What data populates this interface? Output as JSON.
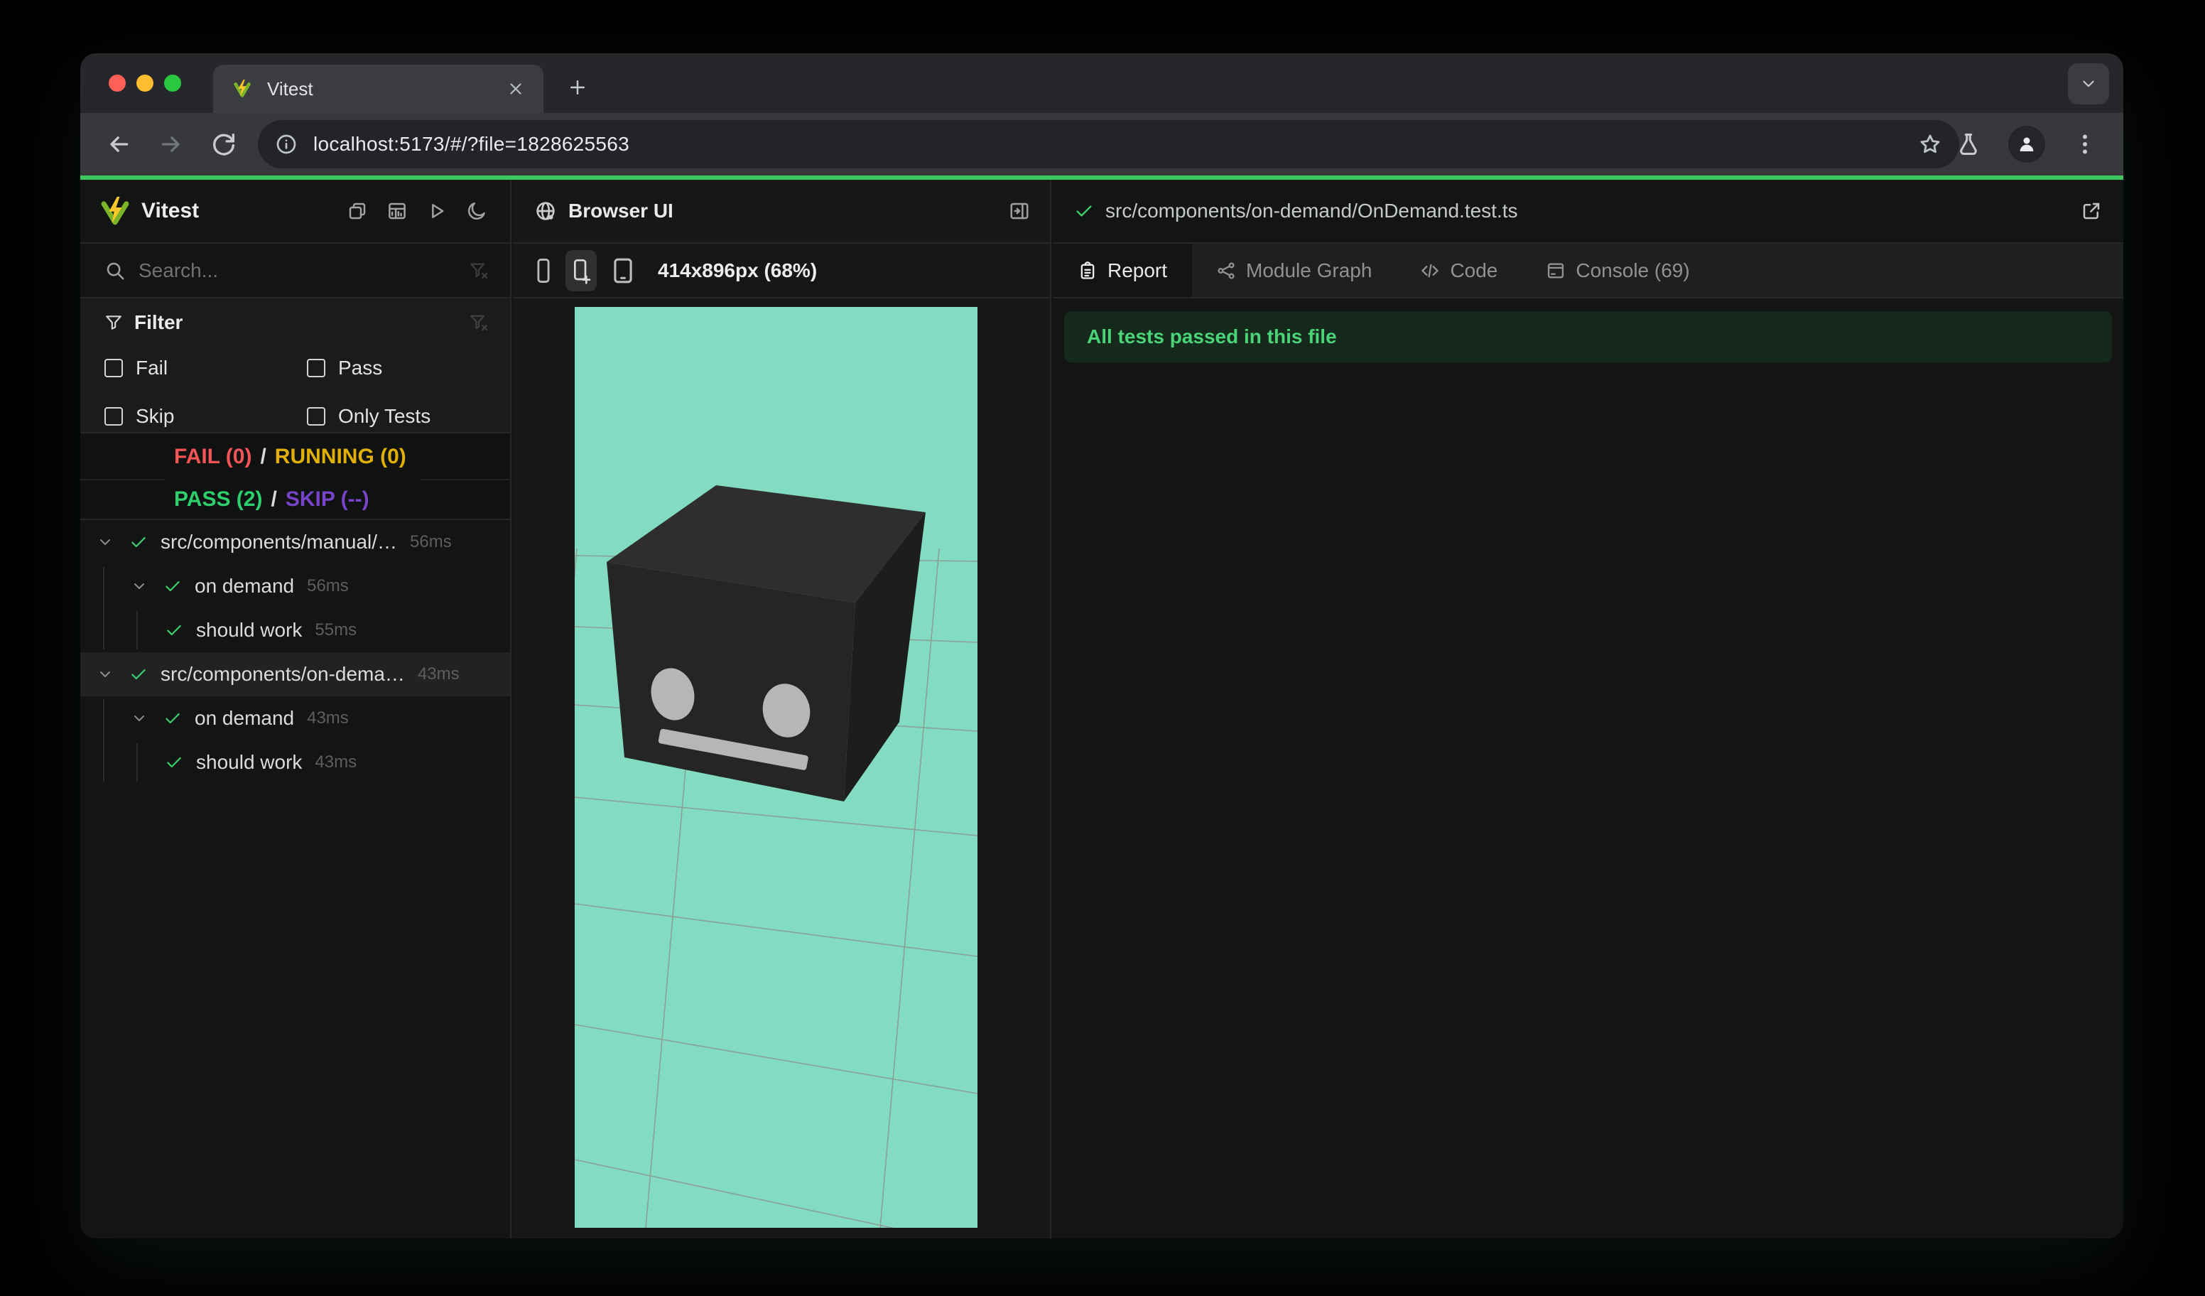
{
  "browser": {
    "tab_title": "Vitest",
    "url": "localhost:5173/#/?file=1828625563"
  },
  "sidebar": {
    "app_title": "Vitest",
    "search_placeholder": "Search...",
    "filter": {
      "title": "Filter",
      "options": [
        "Fail",
        "Pass",
        "Skip",
        "Only Tests"
      ]
    },
    "status": {
      "fail": "FAIL (0)",
      "running": "RUNNING (0)",
      "pass": "PASS (2)",
      "skip": "SKIP (--)",
      "separator": "/"
    },
    "tree": {
      "items": [
        {
          "label": "src/components/manual/…",
          "duration": "56ms",
          "level": 1
        },
        {
          "label": "on demand",
          "duration": "56ms",
          "level": 2
        },
        {
          "label": "should work",
          "duration": "55ms",
          "level": 3
        },
        {
          "label": "src/components/on-dema…",
          "duration": "43ms",
          "level": 1,
          "selected": true
        },
        {
          "label": "on demand",
          "duration": "43ms",
          "level": 2
        },
        {
          "label": "should work",
          "duration": "43ms",
          "level": 3
        }
      ]
    }
  },
  "browser_panel": {
    "title": "Browser UI",
    "viewport_size": "414x896px (68%)"
  },
  "report_panel": {
    "file_path": "src/components/on-demand/OnDemand.test.ts",
    "tabs": [
      "Report",
      "Module Graph",
      "Code",
      "Console (69)"
    ],
    "banner": "All tests passed in this file"
  },
  "icons": {
    "sidebar_actions": [
      "collapse-windows-icon",
      "dashboard-icon",
      "run-all-icon",
      "dark-mode-moon-icon"
    ],
    "toolbar": [
      "back-icon",
      "forward-icon",
      "reload-icon",
      "info-icon",
      "star-icon",
      "flask-icon",
      "profile-icon",
      "menu-dots-icon"
    ]
  },
  "colors": {
    "pass_green": "#2ed06e",
    "fail_red": "#f25555",
    "running_yellow": "#e0b007",
    "skip_purple": "#7643c9",
    "check_green": "#3bd16b",
    "progress_green": "#3cc85e",
    "viewport_mint": "#83dcc2",
    "banner_bg": "#152a1d"
  }
}
